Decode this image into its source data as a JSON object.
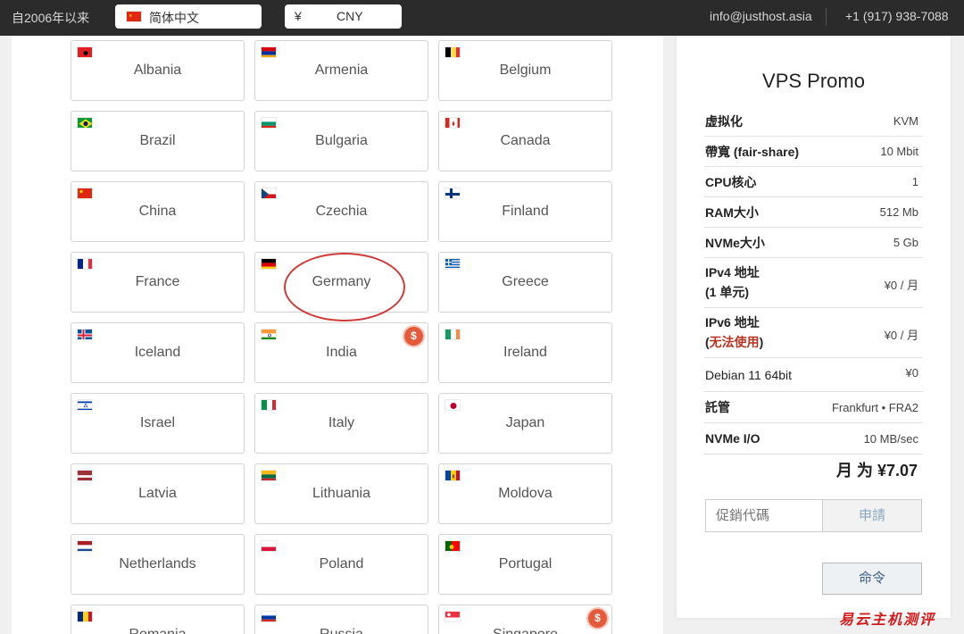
{
  "topbar": {
    "since": "自2006年以来",
    "language": "简体中文",
    "currency_symbol": "¥",
    "currency": "CNY",
    "email": "info@justhost.asia",
    "phone": "+1 (917) 938-7088"
  },
  "countries": [
    {
      "name": "Albania",
      "flag": "albania-flag-icon"
    },
    {
      "name": "Armenia",
      "flag": "armenia-flag-icon"
    },
    {
      "name": "Belgium",
      "flag": "belgium-flag-icon"
    },
    {
      "name": "Brazil",
      "flag": "brazil-flag-icon"
    },
    {
      "name": "Bulgaria",
      "flag": "bulgaria-flag-icon"
    },
    {
      "name": "Canada",
      "flag": "canada-flag-icon"
    },
    {
      "name": "China",
      "flag": "china-flag-icon"
    },
    {
      "name": "Czechia",
      "flag": "czechia-flag-icon"
    },
    {
      "name": "Finland",
      "flag": "finland-flag-icon"
    },
    {
      "name": "France",
      "flag": "france-flag-icon"
    },
    {
      "name": "Germany",
      "flag": "germany-flag-icon"
    },
    {
      "name": "Greece",
      "flag": "greece-flag-icon"
    },
    {
      "name": "Iceland",
      "flag": "iceland-flag-icon"
    },
    {
      "name": "India",
      "flag": "india-flag-icon",
      "badge": "$"
    },
    {
      "name": "Ireland",
      "flag": "ireland-flag-icon"
    },
    {
      "name": "Israel",
      "flag": "israel-flag-icon"
    },
    {
      "name": "Italy",
      "flag": "italy-flag-icon"
    },
    {
      "name": "Japan",
      "flag": "japan-flag-icon"
    },
    {
      "name": "Latvia",
      "flag": "latvia-flag-icon"
    },
    {
      "name": "Lithuania",
      "flag": "lithuania-flag-icon"
    },
    {
      "name": "Moldova",
      "flag": "moldova-flag-icon"
    },
    {
      "name": "Netherlands",
      "flag": "netherlands-flag-icon"
    },
    {
      "name": "Poland",
      "flag": "poland-flag-icon"
    },
    {
      "name": "Portugal",
      "flag": "portugal-flag-icon"
    },
    {
      "name": "Romania",
      "flag": "romania-flag-icon"
    },
    {
      "name": "Russia",
      "flag": "russia-flag-icon"
    },
    {
      "name": "Singapore",
      "flag": "singapore-flag-icon",
      "badge": "$"
    }
  ],
  "sidebar": {
    "title": "VPS Promo",
    "specs": {
      "virt_label": "虚拟化",
      "virt_value": "KVM",
      "bw_label": "帶寬 (fair-share)",
      "bw_value": "10 Mbit",
      "cpu_label": "CPU核心",
      "cpu_value": "1",
      "ram_label": "RAM大小",
      "ram_value": "512 Mb",
      "nvme_label": "NVMe大小",
      "nvme_value": "5 Gb",
      "ipv4_label": "IPv4 地址",
      "ipv4_sub": "(1 单元)",
      "ipv4_value": "¥0 / 月",
      "ipv6_label": "IPv6 地址",
      "ipv6_sub_open": "(",
      "ipv6_sub_red": "无法使用",
      "ipv6_sub_close": ")",
      "ipv6_value": "¥0 / 月",
      "os_label": "Debian 11 64bit",
      "os_value": "¥0",
      "host_label": "託管",
      "host_value": "Frankfurt • FRA2",
      "io_label": "NVMe I/O",
      "io_value": "10 MB/sec"
    },
    "price": "月 为 ¥7.07",
    "promo_placeholder": "促銷代碼",
    "apply_label": "申請",
    "order_label": "命令"
  },
  "watermark": "易云主机测评",
  "colors": {
    "topbar": "#2b2b2b",
    "accent_red": "#b5331f",
    "badge": "#e45a3b"
  }
}
